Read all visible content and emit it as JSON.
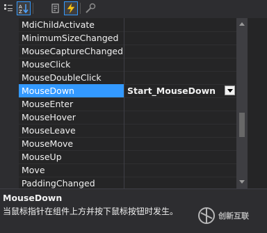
{
  "toolbar": {
    "buttons": [
      {
        "icon": "categorized-icon"
      },
      {
        "icon": "alphabetical-icon"
      },
      {
        "icon": "properties-icon"
      },
      {
        "icon": "events-icon"
      },
      {
        "icon": "property-pages-icon"
      }
    ]
  },
  "events": [
    {
      "name": "MdiChildActivate",
      "value": ""
    },
    {
      "name": "MinimumSizeChanged",
      "value": ""
    },
    {
      "name": "MouseCaptureChanged",
      "value": ""
    },
    {
      "name": "MouseClick",
      "value": ""
    },
    {
      "name": "MouseDoubleClick",
      "value": ""
    },
    {
      "name": "MouseDown",
      "value": "Start_MouseDown"
    },
    {
      "name": "MouseEnter",
      "value": ""
    },
    {
      "name": "MouseHover",
      "value": ""
    },
    {
      "name": "MouseLeave",
      "value": ""
    },
    {
      "name": "MouseMove",
      "value": ""
    },
    {
      "name": "MouseUp",
      "value": ""
    },
    {
      "name": "Move",
      "value": ""
    },
    {
      "name": "PaddingChanged",
      "value": ""
    }
  ],
  "selected_index": 5,
  "description": {
    "title": "MouseDown",
    "text": "当鼠标指针在组件上方并按下鼠标按钮时发生。"
  },
  "watermark": {
    "text": "创新互联"
  },
  "colors": {
    "selection": "#3399ff",
    "background": "#252526"
  }
}
